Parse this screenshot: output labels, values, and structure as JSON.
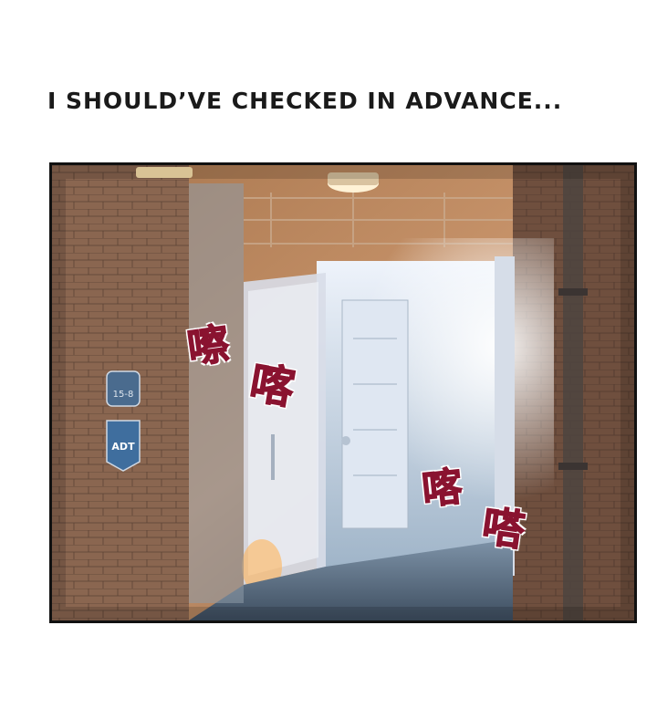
{
  "caption": "I SHOULD’VE CHECKED IN ADVANCE...",
  "sound_effects": [
    "嚓",
    "喀",
    "喀",
    "嗒"
  ],
  "unit_sign": "15-8",
  "security_sign": "ADT",
  "colors": {
    "sfx": "#8a1330",
    "frame": "#111111",
    "brick": "#7a5740",
    "light": "#f4f7ff"
  }
}
